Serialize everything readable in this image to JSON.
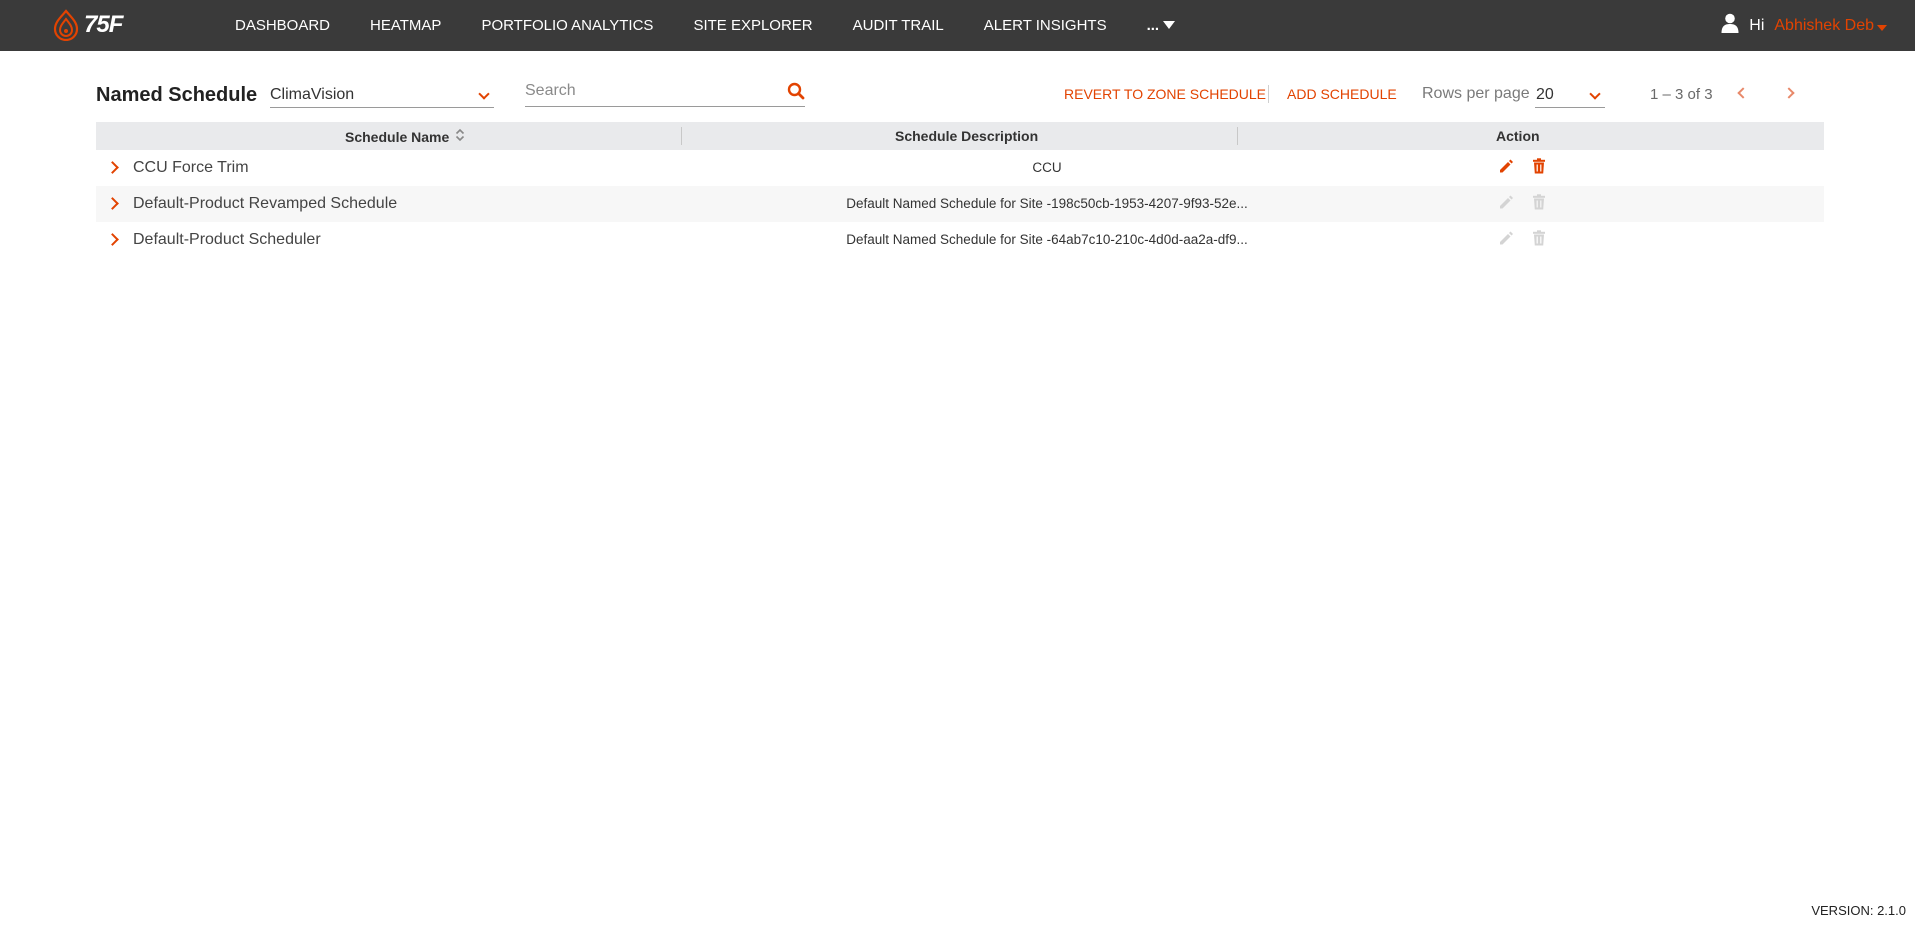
{
  "header": {
    "logo_text": "75F",
    "nav": [
      "DASHBOARD",
      "HEATMAP",
      "PORTFOLIO ANALYTICS",
      "SITE EXPLORER",
      "AUDIT TRAIL",
      "ALERT INSIGHTS"
    ],
    "more_label": "...",
    "greeting": "Hi",
    "user_name": "Abhishek Deb"
  },
  "toolbar": {
    "title": "Named Schedule",
    "site_selected": "ClimaVision",
    "search_placeholder": "Search",
    "revert_label": "REVERT TO ZONE SCHEDULE",
    "add_label": "ADD SCHEDULE",
    "rows_per_page_label": "Rows per page",
    "rows_per_page_value": "20",
    "range_label": "1 – 3 of 3"
  },
  "table": {
    "columns": [
      "Schedule Name",
      "Schedule Description",
      "Action"
    ],
    "rows": [
      {
        "name": "CCU Force Trim",
        "description": "CCU",
        "actions_enabled": true
      },
      {
        "name": "Default-Product Revamped Schedule",
        "description": "Default Named Schedule for Site -198c50cb-1953-4207-9f93-52e...",
        "actions_enabled": false
      },
      {
        "name": "Default-Product Scheduler",
        "description": "Default Named Schedule for Site -64ab7c10-210c-4d0d-aa2a-df9...",
        "actions_enabled": false
      }
    ]
  },
  "footer": {
    "version": "VERSION: 2.1.0"
  },
  "colors": {
    "accent": "#e24301",
    "topbar": "#3a3a3a",
    "header_row": "#e9eaec",
    "disabled_icon": "#d4d4d4"
  }
}
